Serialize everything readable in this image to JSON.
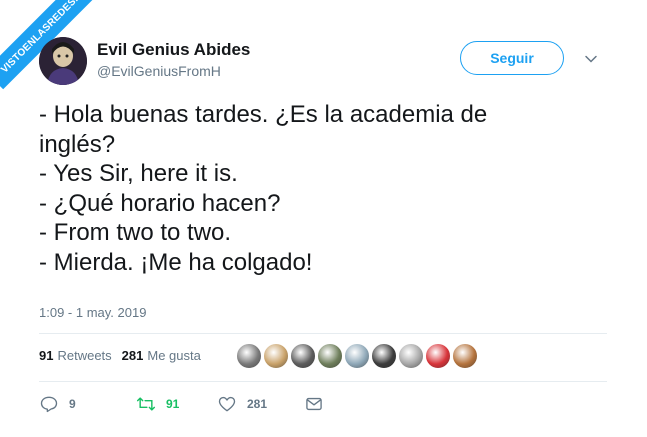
{
  "watermark": {
    "text": "VISTOENLASREDES.com"
  },
  "author": {
    "display_name": "Evil Genius Abides",
    "handle": "@EvilGeniusFromH"
  },
  "follow_button": {
    "label": "Seguir"
  },
  "tweet": {
    "lines": [
      "- Hola buenas tardes. ¿Es la academia de",
      "inglés?",
      "- Yes Sir, here it is.",
      "- ¿Qué horario hacen?",
      "- From two to two.",
      "- Mierda. ¡Me ha colgado!"
    ],
    "timestamp": "1:09 - 1 may. 2019"
  },
  "stats": {
    "retweets_count": "91",
    "retweets_label": "Retweets",
    "likes_count": "281",
    "likes_label": "Me gusta"
  },
  "liker_avatars": [
    {
      "name": "liker-avatar-1",
      "color": "#7a7a7a"
    },
    {
      "name": "liker-avatar-2",
      "color": "#c9a26a"
    },
    {
      "name": "liker-avatar-3",
      "color": "#5d5d5d"
    },
    {
      "name": "liker-avatar-4",
      "color": "#6f7f5c"
    },
    {
      "name": "liker-avatar-5",
      "color": "#8fa8b8"
    },
    {
      "name": "liker-avatar-6",
      "color": "#3d3d3d"
    },
    {
      "name": "liker-avatar-7",
      "color": "#a7a7a7"
    },
    {
      "name": "liker-avatar-8",
      "color": "#d8343a"
    },
    {
      "name": "liker-avatar-9",
      "color": "#b5743e"
    }
  ],
  "actions": {
    "reply_count": "9",
    "retweet_count": "91",
    "like_count": "281"
  },
  "colors": {
    "accent": "#1da1f2",
    "retweet_green": "#17bf63",
    "muted": "#657786"
  }
}
